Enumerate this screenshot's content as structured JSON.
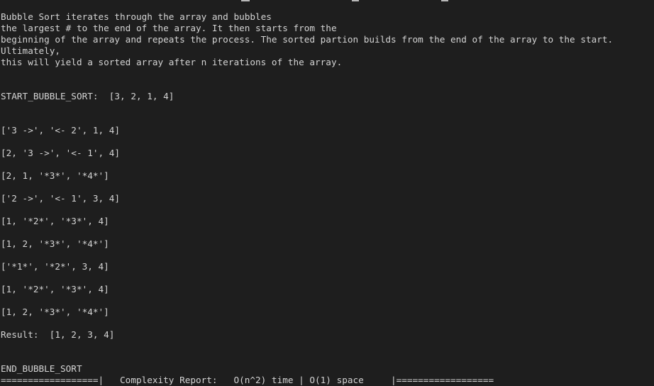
{
  "terminal": {
    "intro": [
      "Bubble Sort iterates through the array and bubbles",
      "the largest # to the end of the array. It then starts from the",
      "beginning of the array and repeats the process. The sorted partion builds from the end of the array to the start.",
      "Ultimately,",
      "this will yield a sorted array after n iterations of the array."
    ],
    "start_line": "START_BUBBLE_SORT:  [3, 2, 1, 4]",
    "steps": [
      "['3 ->', '<- 2', 1, 4]",
      "[2, '3 ->', '<- 1', 4]",
      "[2, 1, '*3*', '*4*']",
      "['2 ->', '<- 1', 3, 4]",
      "[1, '*2*', '*3*', 4]",
      "[1, 2, '*3*', '*4*']",
      "['*1*', '*2*', 3, 4]",
      "[1, '*2*', '*3*', 4]",
      "[1, 2, '*3*', '*4*']"
    ],
    "result_line": "Result:  [1, 2, 3, 4]",
    "end_line": "END_BUBBLE_SORT",
    "report_line": "==================|   Complexity Report:   O(n^2) time | O(1) space     |=================="
  }
}
